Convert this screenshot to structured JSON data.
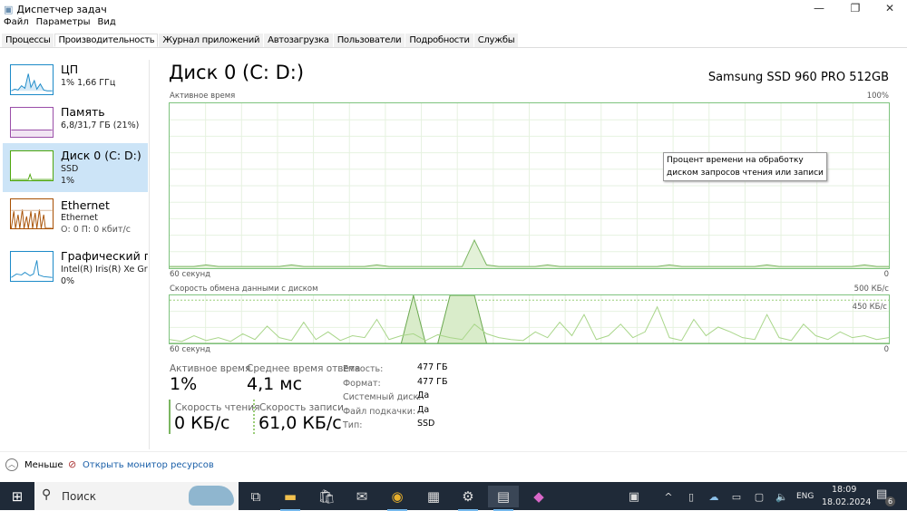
{
  "window": {
    "title": "Диспетчер задач",
    "minimize": "—",
    "restore": "❐",
    "close": "✕"
  },
  "menu": [
    "Файл",
    "Параметры",
    "Вид"
  ],
  "tabs": [
    "Процессы",
    "Производительность",
    "Журнал приложений",
    "Автозагрузка",
    "Пользователи",
    "Подробности",
    "Службы"
  ],
  "active_tab": 1,
  "sidebar": [
    {
      "title": "ЦП",
      "sub1": "1% 1,66 ГГц",
      "color": "#1c8ac8"
    },
    {
      "title": "Память",
      "sub1": "6,8/31,7 ГБ (21%)",
      "color": "#9a4ea8"
    },
    {
      "title": "Диск 0 (C: D:)",
      "sub1": "SSD",
      "sub2": "1%",
      "color": "#4da60c"
    },
    {
      "title": "Ethernet",
      "sub1": "Ethernet",
      "sub2": "О: 0 П: 0 кбит/с",
      "color": "#a74f01"
    },
    {
      "title": "Графический прс",
      "sub1": "Intel(R) Iris(R) Xe Graphics",
      "sub2": "0%",
      "color": "#1c8ac8"
    }
  ],
  "main": {
    "title": "Диск 0 (C: D:)",
    "model": "Samsung SSD 960 PRO 512GB",
    "graph1": {
      "label": "Активное время",
      "max": "100%",
      "min": "0",
      "xlabel": "60 секунд",
      "tooltip1": "Процент времени на обработку",
      "tooltip2": "диском запросов чтения или записи"
    },
    "graph2": {
      "label": "Скорость обмена данными с диском",
      "max": "500 КБ/с",
      "mark": "450 КБ/с",
      "min": "0",
      "xlabel": "60 секунд"
    },
    "stats": {
      "active_label": "Активное время",
      "active_value": "1%",
      "resp_label": "Среднее время ответа",
      "resp_value": "4,1 мс",
      "read_label": "Скорость чтения",
      "read_value": "0 КБ/с",
      "write_label": "Скорость записи",
      "write_value": "61,0 КБ/с"
    },
    "props": [
      {
        "label": "Емкость:",
        "value": "477 ГБ"
      },
      {
        "label": "Формат:",
        "value": "477 ГБ"
      },
      {
        "label": "Системный диск:",
        "value": "Да"
      },
      {
        "label": "Файл подкачки:",
        "value": "Да"
      },
      {
        "label": "Тип:",
        "value": "SSD"
      }
    ]
  },
  "footer": {
    "less": "Меньше",
    "monitor": "Открыть монитор ресурсов"
  },
  "taskbar": {
    "search": "Поиск",
    "lang": "ENG",
    "time": "18:09",
    "date": "18.02.2024",
    "notifications": "6"
  },
  "chart_data": [
    {
      "type": "area",
      "title": "Активное время",
      "ylim": [
        0,
        100
      ],
      "x_range_seconds": 60,
      "values": [
        1,
        1,
        1,
        2,
        1,
        1,
        1,
        1,
        1,
        1,
        2,
        1,
        1,
        1,
        1,
        1,
        1,
        2,
        1,
        1,
        1,
        1,
        1,
        1,
        1,
        17,
        2,
        1,
        1,
        1,
        1,
        2,
        1,
        1,
        1,
        1,
        1,
        1,
        1,
        1,
        1,
        2,
        1,
        1,
        1,
        1,
        1,
        1,
        1,
        2,
        1,
        1,
        1,
        1,
        1,
        1,
        1,
        2,
        1,
        1
      ]
    },
    {
      "type": "line",
      "title": "Скорость обмена данными с диском",
      "ylim": [
        0,
        500
      ],
      "x_range_seconds": 60,
      "series": [
        {
          "name": "Скорость чтения",
          "values": [
            0,
            0,
            0,
            0,
            0,
            0,
            0,
            0,
            0,
            0,
            0,
            0,
            0,
            0,
            0,
            0,
            0,
            0,
            0,
            0,
            500,
            0,
            0,
            500,
            500,
            500,
            0,
            0,
            0,
            0,
            0,
            0,
            0,
            0,
            0,
            0,
            0,
            0,
            0,
            0,
            0,
            0,
            0,
            0,
            0,
            0,
            0,
            0,
            0,
            0,
            0,
            0,
            0,
            0,
            0,
            0,
            0,
            0,
            0,
            0
          ]
        },
        {
          "name": "Скорость записи",
          "values": [
            40,
            20,
            80,
            30,
            60,
            20,
            100,
            40,
            180,
            60,
            30,
            220,
            40,
            120,
            30,
            80,
            60,
            250,
            40,
            80,
            100,
            30,
            90,
            60,
            40,
            200,
            100,
            60,
            40,
            30,
            120,
            60,
            220,
            80,
            300,
            40,
            80,
            200,
            60,
            120,
            380,
            60,
            30,
            250,
            80,
            170,
            120,
            60,
            40,
            300,
            60,
            30,
            200,
            80,
            40,
            120,
            60,
            80,
            40,
            60
          ]
        }
      ]
    }
  ]
}
